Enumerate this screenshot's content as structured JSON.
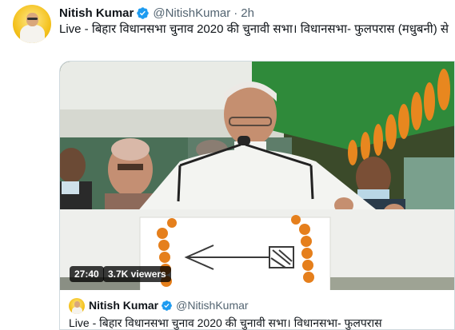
{
  "tweet": {
    "author_name": "Nitish Kumar",
    "author_handle": "@NitishKumar",
    "separator": "·",
    "timestamp": "2h",
    "text": "Live - बिहार विधानसभा चुनाव 2020 की चुनावी सभा। विधानसभा-  फुलपरास (मधुबनी) से"
  },
  "video": {
    "duration": "27:40",
    "viewers": "3.7K viewers"
  },
  "quoted_tweet": {
    "author_name": "Nitish Kumar",
    "author_handle": "@NitishKumar",
    "text": "Live - बिहार विधानसभा चुनाव 2020 की चुनावी सभा। विधानसभा- फुलपरास"
  },
  "colors": {
    "verified": "#1d9bf0",
    "secondary_text": "#536471",
    "border": "#cfd9de"
  },
  "icons": {
    "verified": "verified-badge-icon"
  }
}
